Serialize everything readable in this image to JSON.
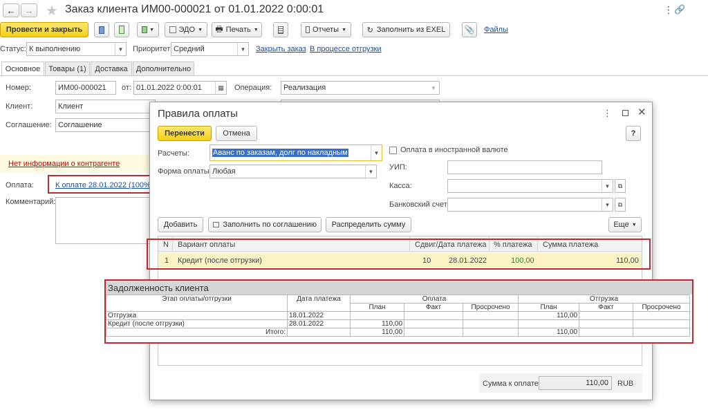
{
  "window": {
    "title": "Заказ клиента ИМ00-000021 от 01.01.2022 0:00:01"
  },
  "toolbar": {
    "post_close": "Провести и закрыть",
    "edo": "ЭДО",
    "print": "Печать",
    "reports": "Отчеты",
    "fill_excel": "Заполнить из EXEL",
    "files": "Файлы"
  },
  "status_row": {
    "status_label": "Статус:",
    "status_value": "К выполнению",
    "priority_label": "Приоритет:",
    "priority_value": "Средний",
    "close_order": "Закрыть заказ",
    "in_shipment": "В процессе отгрузки"
  },
  "tabs": [
    "Основное",
    "Товары (1)",
    "Доставка",
    "Дополнительно"
  ],
  "form": {
    "number_label": "Номер:",
    "number_value": "ИМ00-000021",
    "from_label": "от:",
    "date_value": "01.01.2022  0:00:01",
    "operation_label": "Операция:",
    "operation_value": "Реализация",
    "client_label": "Клиент:",
    "client_value": "Клиент",
    "agreement_label": "Соглашение:",
    "agreement_value": "Соглашение",
    "no_info": "Нет информации о контрагенте",
    "payment_label": "Оплата:",
    "payment_link": "К оплате 28.01.2022 (100%)",
    "comment_label": "Комментарий:"
  },
  "modal": {
    "title": "Правила оплаты",
    "transfer": "Перенести",
    "cancel": "Отмена",
    "help": "?",
    "calc_label": "Расчеты:",
    "calc_value": "Аванс по заказам, долг по накладным",
    "foreign_currency": "Оплата в иностранной валюте",
    "form_label": "Форма оплаты:",
    "form_value": "Любая",
    "uip_label": "УИП:",
    "cash_label": "Касса:",
    "bank_label": "Банковский счет:",
    "add": "Добавить",
    "fill_by_agreement": "Заполнить по соглашению",
    "distribute": "Распределить сумму",
    "more": "Еще",
    "table": {
      "headers": [
        "N",
        "Вариант оплаты",
        "Сдвиг/Дата платежа",
        "% платежа",
        "Сумма платежа"
      ],
      "rows": [
        {
          "n": "1",
          "variant": "Кредит (после отгрузки)",
          "shift": "10",
          "date": "28.01.2022",
          "percent": "100,00",
          "sum": "110,00"
        }
      ]
    },
    "total_label": "Сумма к оплате:",
    "total_value": "110,00",
    "currency": "RUB"
  },
  "debt": {
    "title": "Задолженность клиента",
    "col_stage": "Этап оплаты/отгрузки",
    "col_date": "Дата платежа",
    "col_payment": "Оплата",
    "col_shipment": "Отгрузка",
    "col_plan": "План",
    "col_fact": "Факт",
    "col_overdue": "Просрочено",
    "rows": [
      {
        "stage": "Отгрузка",
        "date": "18.01.2022",
        "pay_plan": "",
        "pay_fact": "",
        "pay_overdue": "",
        "ship_plan": "110,00",
        "ship_fact": "",
        "ship_overdue": ""
      },
      {
        "stage": "Кредит (после отгрузки)",
        "date": "28.01.2022",
        "pay_plan": "110,00",
        "pay_fact": "",
        "pay_overdue": "",
        "ship_plan": "",
        "ship_fact": "",
        "ship_overdue": ""
      }
    ],
    "total": {
      "label": "Итого:",
      "pay_plan": "110,00",
      "ship_plan": "110,00"
    }
  }
}
